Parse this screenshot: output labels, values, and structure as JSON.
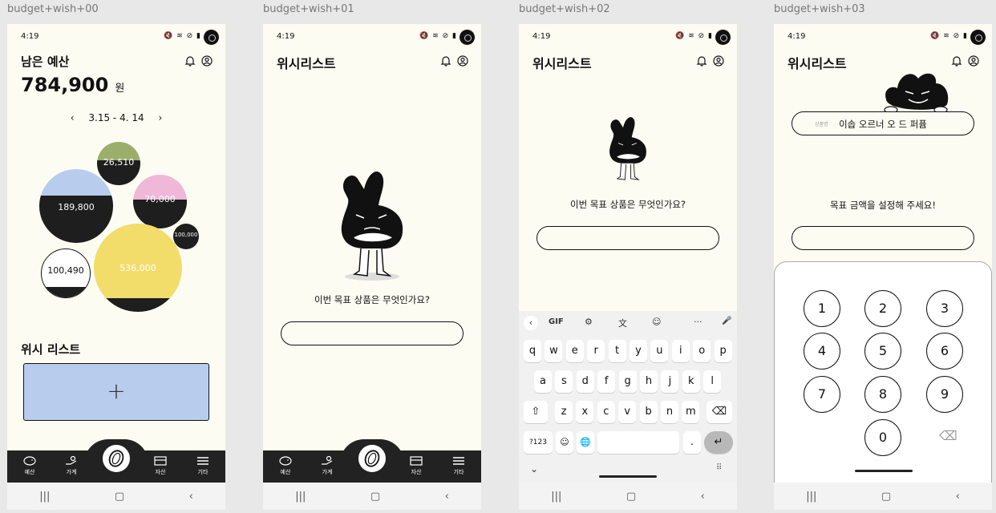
{
  "frames": [
    {
      "label": "budget+wish+00"
    },
    {
      "label": "budget+wish+01"
    },
    {
      "label": "budget+wish+02"
    },
    {
      "label": "budget+wish+03"
    }
  ],
  "status": {
    "time": "4:19",
    "icons": "🔇 ≋ ⊘ ▮"
  },
  "screen0": {
    "title": "남은 예산",
    "amount": "784,900",
    "currency": "원",
    "period": "3.15 - 4. 14",
    "bubbles": [
      {
        "value": "26,510",
        "color": "#9caf6a"
      },
      {
        "value": "189,800",
        "color": "#b8cdee"
      },
      {
        "value": "70,000",
        "color": "#f0b8d8"
      },
      {
        "value": "100,000",
        "color": "#1e1e1e"
      },
      {
        "value": "100,490",
        "color": "#ffffff"
      },
      {
        "value": "536,000",
        "color": "#f2dc6a"
      }
    ],
    "wishlist_title": "위시 리스트",
    "add_label": "+"
  },
  "title_wishlist": "위시리스트",
  "question": "이번 목표 상품은 무엇인가요?",
  "screen3": {
    "field_label": "상품명",
    "product_name": "이솝 오르너 오 드 퍼퓸",
    "prompt": "목표 금액을 설정해 주세요!"
  },
  "nav": {
    "budget": "예산",
    "household": "가계",
    "assets": "자산",
    "more": "기타"
  },
  "sysnav": {
    "recent": "|||",
    "home": "▢",
    "back": "‹"
  },
  "keyboard": {
    "toolbar": [
      "‹",
      "GIF",
      "⚙",
      "文",
      "☺",
      "···",
      "🎤"
    ],
    "row1": [
      "q",
      "w",
      "e",
      "r",
      "t",
      "y",
      "u",
      "i",
      "o",
      "p"
    ],
    "row2": [
      "a",
      "s",
      "d",
      "f",
      "g",
      "h",
      "j",
      "k",
      "l"
    ],
    "row3": [
      "z",
      "x",
      "c",
      "v",
      "b",
      "n",
      "m"
    ],
    "sym": "?123",
    "emoji": "☺",
    "lang": "🌐",
    "period": ".",
    "enter": "↵",
    "shift": "⇧",
    "backspace": "⌫",
    "hide": "⌄",
    "grid": "⠿"
  },
  "numpad": {
    "keys": [
      "1",
      "2",
      "3",
      "4",
      "5",
      "6",
      "7",
      "8",
      "9",
      "0"
    ],
    "backspace": "⌫"
  }
}
